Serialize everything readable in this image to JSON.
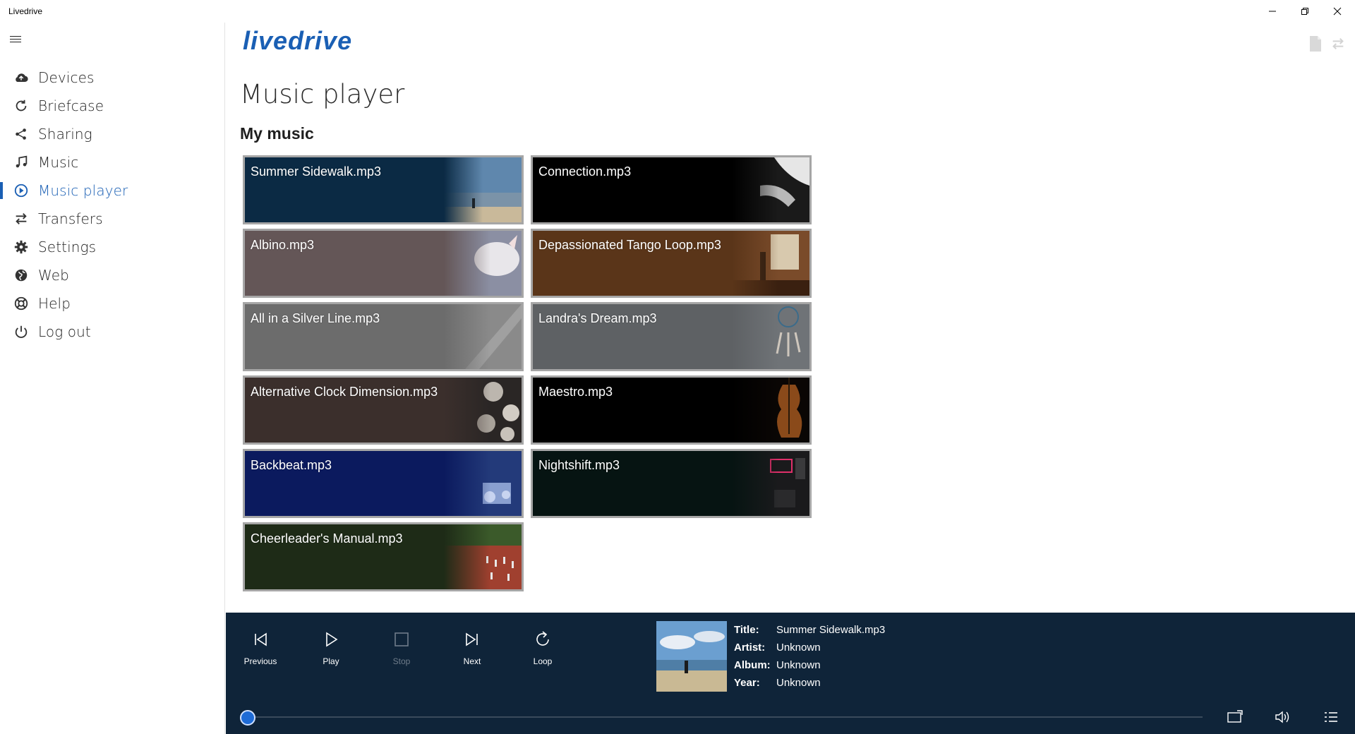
{
  "window": {
    "title": "Livedrive"
  },
  "sidebar": {
    "items": [
      {
        "label": "Devices",
        "icon": "cloud-upload-icon"
      },
      {
        "label": "Briefcase",
        "icon": "sync-icon"
      },
      {
        "label": "Sharing",
        "icon": "share-icon"
      },
      {
        "label": "Music",
        "icon": "music-note-icon"
      },
      {
        "label": "Music player",
        "icon": "play-circle-icon",
        "active": true
      },
      {
        "label": "Transfers",
        "icon": "transfer-arrows-icon"
      },
      {
        "label": "Settings",
        "icon": "gear-icon"
      },
      {
        "label": "Web",
        "icon": "globe-icon"
      },
      {
        "label": "Help",
        "icon": "lifebuoy-icon"
      },
      {
        "label": "Log out",
        "icon": "power-icon"
      }
    ]
  },
  "header": {
    "logo": "livedrive"
  },
  "main": {
    "title": "Music player",
    "section": "My music",
    "tracks": [
      {
        "name": "Summer Sidewalk.mp3",
        "color": "#0b2a44"
      },
      {
        "name": "Connection.mp3",
        "color": "#000000"
      },
      {
        "name": "Albino.mp3",
        "color": "#645657"
      },
      {
        "name": "Depassionated Tango Loop.mp3",
        "color": "#5a3519"
      },
      {
        "name": "All in a Silver Line.mp3",
        "color": "#6c6c6c"
      },
      {
        "name": "Landra's Dream.mp3",
        "color": "#5e6164"
      },
      {
        "name": "Alternative Clock Dimension.mp3",
        "color": "#3b2f2c"
      },
      {
        "name": "Maestro.mp3",
        "color": "#000000"
      },
      {
        "name": "Backbeat.mp3",
        "color": "#0b1a5e"
      },
      {
        "name": "Nightshift.mp3",
        "color": "#061412"
      },
      {
        "name": "Cheerleader's Manual.mp3",
        "color": "#1e2b17"
      }
    ]
  },
  "player": {
    "buttons": {
      "previous": "Previous",
      "play": "Play",
      "stop": "Stop",
      "next": "Next",
      "loop": "Loop"
    },
    "meta": {
      "title_key": "Title:",
      "title": "Summer Sidewalk.mp3",
      "artist_key": "Artist:",
      "artist": "Unknown",
      "album_key": "Album:",
      "album": "Unknown",
      "year_key": "Year:",
      "year": "Unknown"
    },
    "progress": 0
  }
}
